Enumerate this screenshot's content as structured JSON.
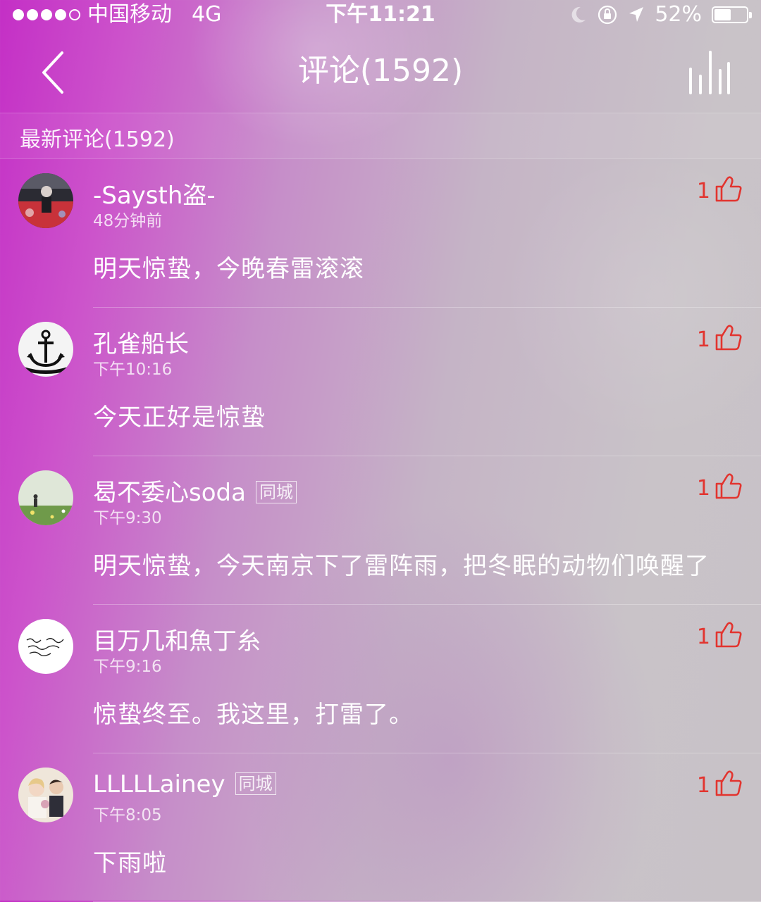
{
  "status_bar": {
    "carrier": "中国移动",
    "network": "4G",
    "time": "下午11:21",
    "battery": "52%",
    "battery_level": 0.52,
    "signal_bars_filled": 4,
    "signal_bars_total": 5
  },
  "header": {
    "title": "评论(1592)",
    "back_icon": "chevron-left-icon",
    "player_icon": "equalizer-icon"
  },
  "section": {
    "label": "最新评论(1592)"
  },
  "colors": {
    "accent": "#e2342f",
    "gradient_left": "#c42fc6",
    "gradient_right": "#c8c2c7"
  },
  "comments": [
    {
      "user": "-Saysth盗-",
      "badge": "",
      "time": "48分钟前",
      "text": "明天惊蛰，今晚春雷滚滚",
      "likes": "1"
    },
    {
      "user": "孔雀船长",
      "badge": "",
      "time": "下午10:16",
      "text": "今天正好是惊蛰",
      "likes": "1"
    },
    {
      "user": "曷不委心soda",
      "badge": "同城",
      "time": "下午9:30",
      "text": "明天惊蛰，今天南京下了雷阵雨，把冬眠的动物们唤醒了",
      "likes": "1"
    },
    {
      "user": "目万几和魚丁糸",
      "badge": "",
      "time": "下午9:16",
      "text": "惊蛰终至。我这里，打雷了。",
      "likes": "1"
    },
    {
      "user": "LLLLLainey",
      "badge": "同城",
      "time": "下午8:05",
      "text": "下雨啦",
      "likes": "1"
    }
  ]
}
